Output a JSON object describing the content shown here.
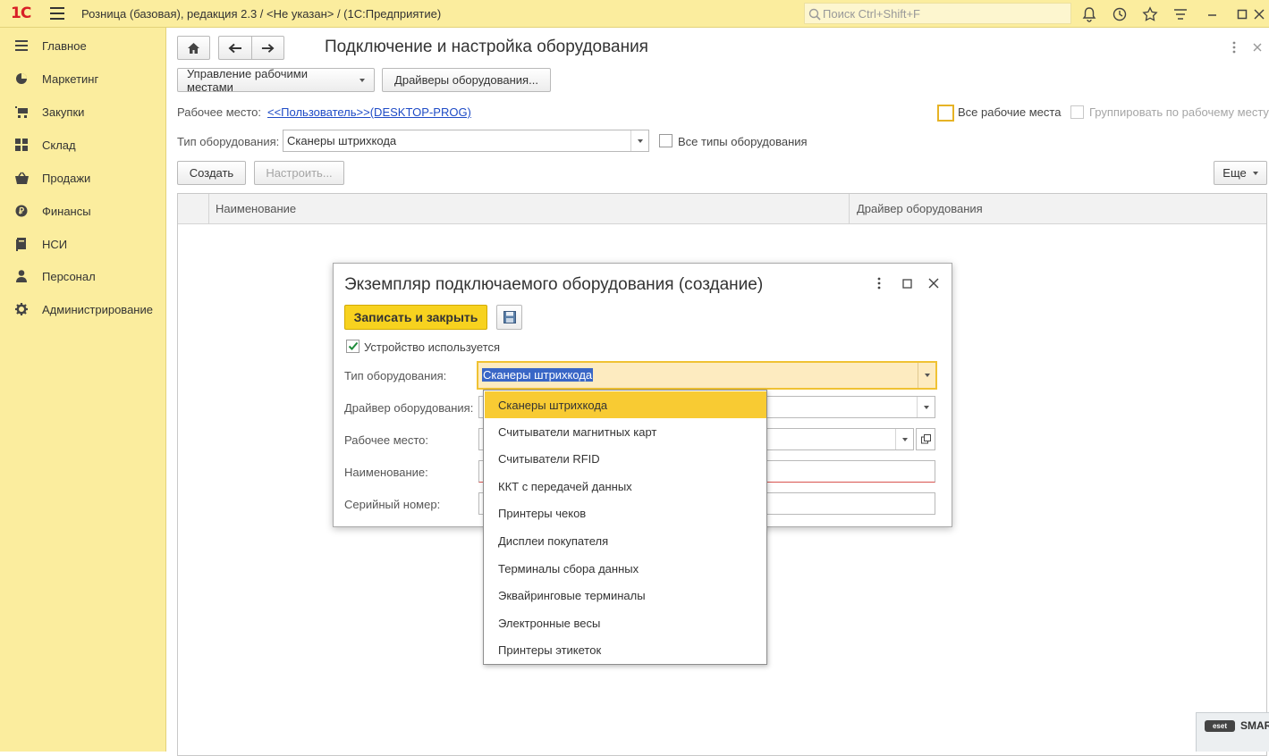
{
  "app": {
    "logo": "1С",
    "title": "Розница (базовая), редакция 2.3 / <Не указан> /  (1С:Предприятие)",
    "search_placeholder": "Поиск Ctrl+Shift+F"
  },
  "colors": {
    "panel": "#fbed9e",
    "accent": "#f7d21f",
    "selected": "#f8cb33",
    "link": "#1e4bc6"
  },
  "sidebar": {
    "items": [
      {
        "label": "Главное",
        "icon": "menu-lines-icon"
      },
      {
        "label": "Маркетинг",
        "icon": "pie-icon"
      },
      {
        "label": "Закупки",
        "icon": "cart-icon"
      },
      {
        "label": "Склад",
        "icon": "grid-icon"
      },
      {
        "label": "Продажи",
        "icon": "basket-icon"
      },
      {
        "label": "Финансы",
        "icon": "ruble-icon"
      },
      {
        "label": "НСИ",
        "icon": "book-icon"
      },
      {
        "label": "Персонал",
        "icon": "person-icon"
      },
      {
        "label": "Администрирование",
        "icon": "gear-icon"
      }
    ]
  },
  "page": {
    "title": "Подключение и настройка оборудования",
    "btn_workplaces": "Управление рабочими местами",
    "btn_drivers": "Драйверы оборудования...",
    "workplace_label": "Рабочее место:",
    "workplace_value": "<<Пользователь>>(DESKTOP-PROG)",
    "all_workplaces": "Все рабочие места",
    "group_by_workplace": "Группировать по рабочему месту",
    "equip_type_label": "Тип оборудования:",
    "equip_type_value": "Сканеры штрихкода",
    "all_types": "Все типы оборудования",
    "btn_create": "Создать",
    "btn_configure": "Настроить...",
    "btn_more": "Еще",
    "columns": [
      "Наименование",
      "Драйвер оборудования"
    ]
  },
  "dialog": {
    "title": "Экземпляр подключаемого оборудования (создание)",
    "btn_save_close": "Записать и закрыть",
    "device_used": "Устройство используется",
    "device_used_checked": true,
    "f_type": "Тип оборудования:",
    "f_type_value": "Сканеры штрихкода",
    "f_driver": "Драйвер оборудования:",
    "f_workplace": "Рабочее место:",
    "f_name": "Наименование:",
    "f_serial": "Серийный номер:"
  },
  "dropdown": {
    "options": [
      "Сканеры штрихкода",
      "Считыватели магнитных карт",
      "Считыватели RFID",
      "ККТ с передачей данных",
      "Принтеры чеков",
      "Дисплеи покупателя",
      "Терминалы сбора данных",
      "Эквайринговые терминалы",
      "Электронные весы",
      "Принтеры этикеток"
    ],
    "selected_index": 0
  },
  "tray": {
    "label": "SMAR"
  }
}
